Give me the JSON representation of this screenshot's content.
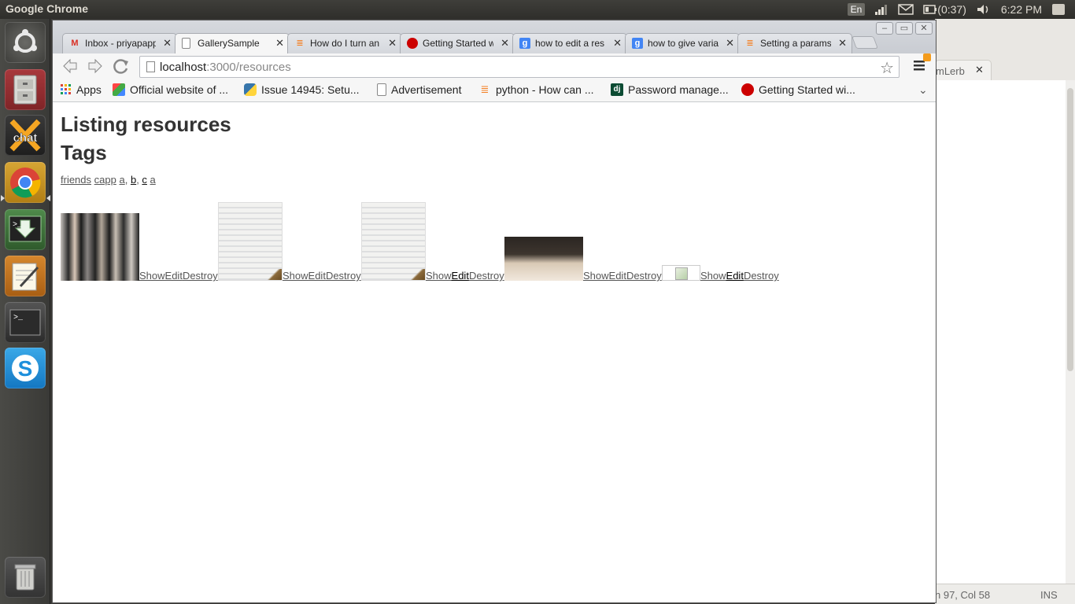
{
  "top_panel": {
    "app_title": "Google Chrome",
    "keyboard_layout": "En",
    "battery_time": "(0:37)",
    "clock": "6:22 PM"
  },
  "launcher": {
    "items": [
      "dash-home",
      "files",
      "xchat",
      "chrome",
      "software-install",
      "text-editor",
      "terminal",
      "skype",
      "trash"
    ],
    "xchat_label": "chat"
  },
  "background_editor": {
    "tab_label": "mLerb",
    "status_position": "n 97, Col 58",
    "status_mode": "INS"
  },
  "browser": {
    "tabs": [
      {
        "title": "Inbox - priyapapp",
        "icon": "gmail-icon",
        "active": false
      },
      {
        "title": "GallerySample",
        "icon": "page-icon",
        "active": true
      },
      {
        "title": "How do I turn an",
        "icon": "stackoverflow-icon",
        "active": false
      },
      {
        "title": "Getting Started w",
        "icon": "rails-icon",
        "active": false
      },
      {
        "title": "how to edit a res",
        "icon": "google-icon",
        "active": false
      },
      {
        "title": "how to give varia",
        "icon": "google-icon",
        "active": false
      },
      {
        "title": "Setting a params",
        "icon": "stackoverflow-icon",
        "active": false
      }
    ],
    "url_host": "localhost",
    "url_path": ":3000/resources",
    "bookmarks": [
      {
        "label": "Apps",
        "icon": "apps-grid-icon"
      },
      {
        "label": "Official website of ...",
        "icon": "joomla-icon"
      },
      {
        "label": "Issue 14945: Setu...",
        "icon": "python-icon"
      },
      {
        "label": "Advertisement",
        "icon": "page-icon"
      },
      {
        "label": "python - How can ...",
        "icon": "stackoverflow-icon"
      },
      {
        "label": "Password manage...",
        "icon": "django-icon"
      },
      {
        "label": "Getting Started wi...",
        "icon": "rails-icon"
      }
    ]
  },
  "page": {
    "title": "Listing resources",
    "tags_heading": "Tags",
    "tags": [
      "friends",
      "capp",
      "a",
      "b",
      "c",
      "a"
    ],
    "tag_separators": [
      " ",
      " ",
      ", ",
      ", ",
      " "
    ],
    "resources": [
      {
        "show": "Show",
        "edit": "Edit",
        "destroy": "Destroy"
      },
      {
        "show": "Show",
        "edit": "Edit",
        "destroy": "Destroy"
      },
      {
        "show": "Show",
        "edit": "Edit",
        "destroy": "Destroy"
      },
      {
        "show": "Show",
        "edit": "Edit",
        "destroy": "Destroy"
      },
      {
        "show": "Show",
        "edit": "Edit",
        "destroy": "Destroy"
      }
    ]
  }
}
